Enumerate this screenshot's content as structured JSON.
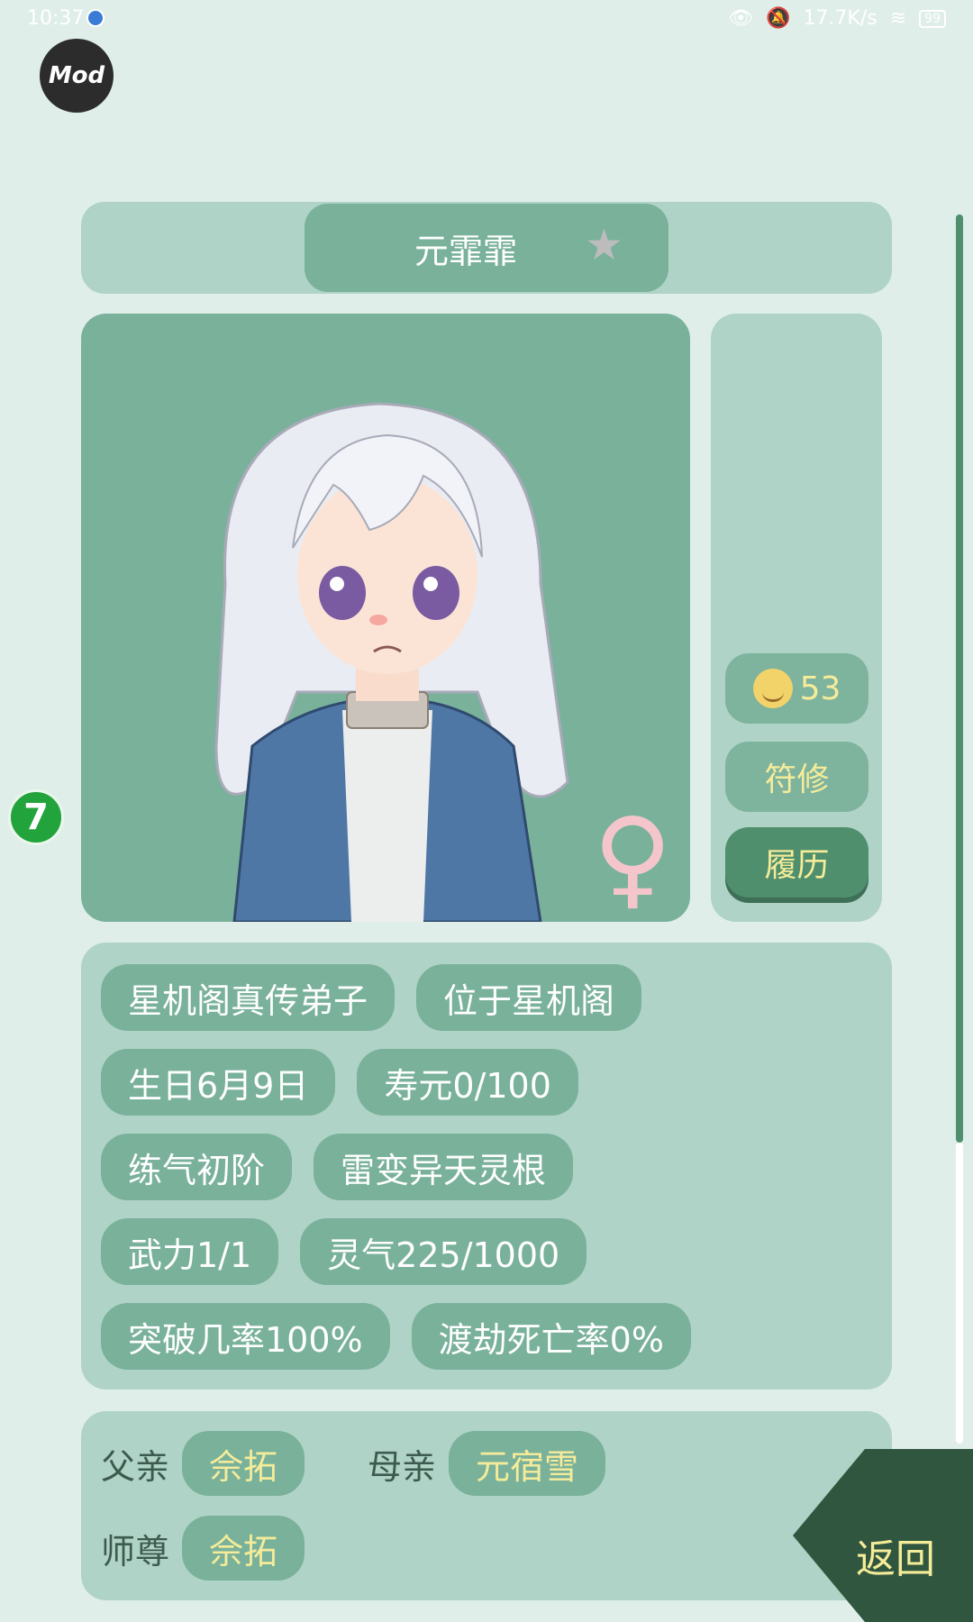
{
  "status_bar": {
    "time": "10:37",
    "network_speed": "17.7K/s",
    "battery": "99"
  },
  "mod_badge": "Mod",
  "side_logo": "7",
  "character": {
    "name": "元霏霏",
    "gender_symbol": "♀"
  },
  "side_panel": {
    "mood_value": "53",
    "profession": "符修",
    "history_button": "履历"
  },
  "stats": [
    [
      "星机阁真传弟子",
      "位于星机阁"
    ],
    [
      "生日6月9日",
      "寿元0/100"
    ],
    [
      "练气初阶",
      "雷变异天灵根"
    ],
    [
      "武力1/1",
      "灵气225/1000"
    ],
    [
      "突破几率100%",
      "渡劫死亡率0%"
    ]
  ],
  "family": {
    "father_label": "父亲",
    "father": "佘拓",
    "mother_label": "母亲",
    "mother": "元宿雪",
    "master_label": "师尊",
    "master": "佘拓"
  },
  "back_button": "返回",
  "colors": {
    "background": "#dfeee9",
    "panel": "#afd3c6",
    "pill": "#79b19b",
    "accent_text": "#f5ec9a",
    "dark": "#31563f"
  }
}
